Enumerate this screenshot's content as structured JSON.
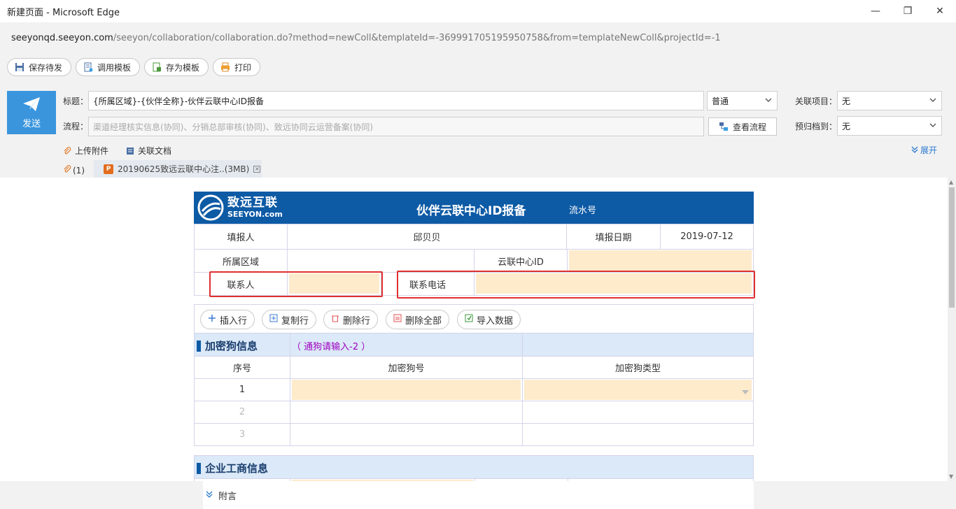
{
  "window": {
    "title": "新建页面 - Microsoft Edge",
    "minimize": "—",
    "restore": "❐",
    "close": "✕",
    "url_host": "seeyonqd.seeyon.com",
    "url_path": "/seeyon/collaboration/collaboration.do?method=newColl&templateId=-369991705195950758&from=templateNewColl&projectId=-1"
  },
  "toolbar": {
    "save_draft": "保存待发",
    "use_template": "调用模板",
    "save_template": "存为模板",
    "print": "打印"
  },
  "header": {
    "send_label": "发送",
    "title_label": "标题：",
    "title_value": "{所属区域}-{伙伴全称}-伙伴云联中心ID报备",
    "priority_value": "普通",
    "related_project_label": "关联项目：",
    "related_project_value": "无",
    "flow_label": "流程：",
    "flow_value": "渠道经理核实信息(协同)、分销总部审核(协同)、致远协同云运营备案(协同)",
    "view_flow": "查看流程",
    "archive_label": "预归档到：",
    "archive_value": "无",
    "upload_attachment": "上传附件",
    "related_doc": "关联文档",
    "expand": "展开",
    "attachment_count": "(1)",
    "attachment_name": "20190625致远云联中心注..(3MB)"
  },
  "form": {
    "logo_cn": "致远互联",
    "logo_en": "SEEYON.com",
    "title": "伙伴云联中心ID报备",
    "serial_label": "流水号",
    "reporter_label": "填报人",
    "reporter_value": "邱贝贝",
    "date_label": "填报日期",
    "date_value": "2019-07-12",
    "region_label": "所属区域",
    "region_value": "",
    "center_id_label": "云联中心ID",
    "contact_label": "联系人",
    "phone_label": "联系电话"
  },
  "subtable": {
    "insert_row": "插入行",
    "copy_row": "复制行",
    "delete_row": "删除行",
    "delete_all": "删除全部",
    "import_data": "导入数据",
    "section_title": "加密狗信息",
    "hint": "（ 通狗请输入-2 ）",
    "col_seq": "序号",
    "col_dongle_no": "加密狗号",
    "col_dongle_type": "加密狗类型",
    "rows": [
      "1",
      "2",
      "3"
    ]
  },
  "section2": {
    "title": "企业工商信息"
  },
  "footer": {
    "note_label": "附言"
  }
}
